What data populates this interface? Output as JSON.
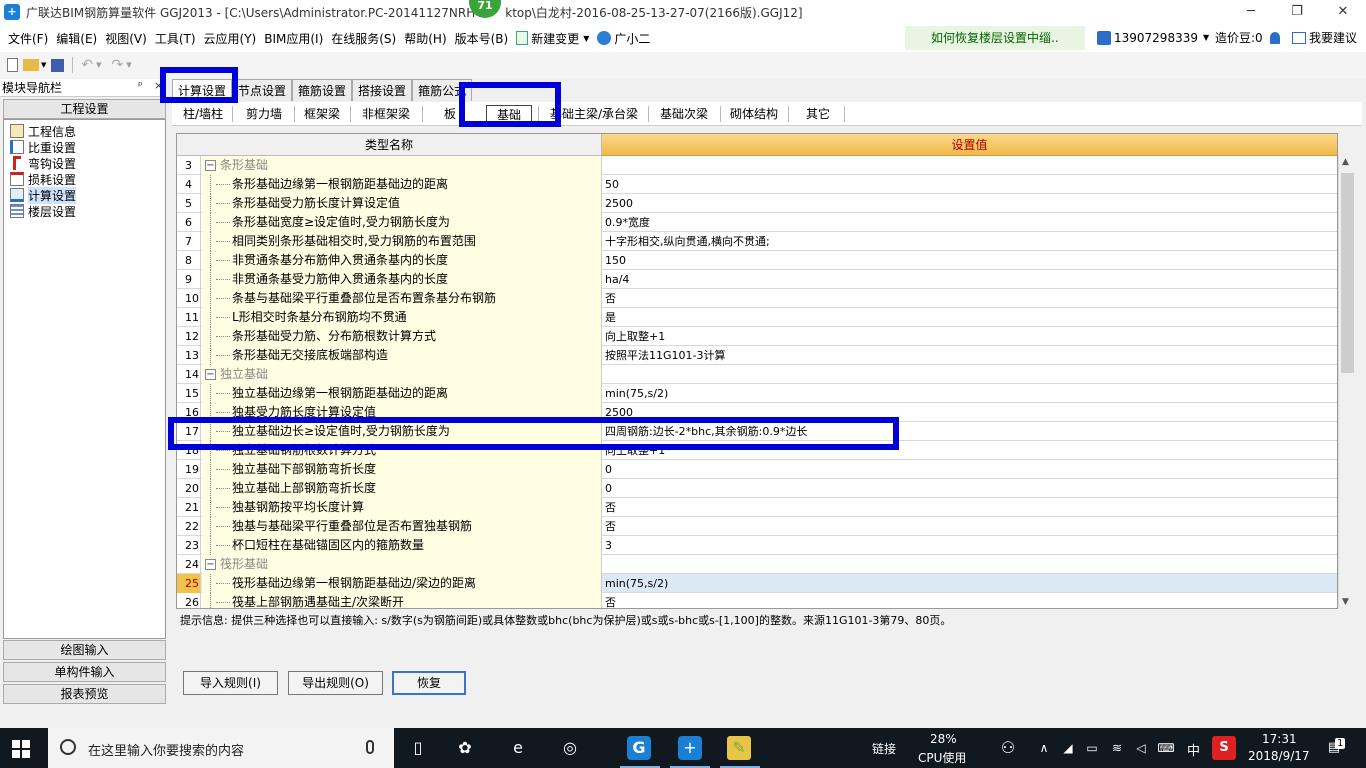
{
  "window": {
    "title": "广联达BIM钢筋算量软件 GGJ2013 - [C:\\Users\\Administrator.PC-20141127NRH",
    "title_tail": "ktop\\白龙村-2016-08-25-13-27-07(2166版).GGJ12]",
    "badge": "71",
    "min_icon": "minimize-icon",
    "restore_icon": "restore-icon",
    "close_icon": "close-icon"
  },
  "menu": {
    "items": [
      "文件(F)",
      "编辑(E)",
      "视图(V)",
      "工具(T)",
      "云应用(Y)",
      "BIM应用(I)",
      "在线服务(S)",
      "帮助(H)",
      "版本号(B)"
    ],
    "new_change": "新建变更",
    "guang_xiao_er": "广小二",
    "hint": "如何恢复楼层设置中缁..",
    "phone": "13907298339",
    "beans": "造价豆:0",
    "suggest": "我要建议"
  },
  "nav": {
    "title": "模块导航栏",
    "pin": "ₚ",
    "close": "×",
    "section": "工程设置",
    "items": [
      {
        "label": "工程信息",
        "icon": "info-icon"
      },
      {
        "label": "比重设置",
        "icon": "weight-icon"
      },
      {
        "label": "弯钩设置",
        "icon": "hook-icon"
      },
      {
        "label": "损耗设置",
        "icon": "loss-icon"
      },
      {
        "label": "计算设置",
        "icon": "calc-icon"
      },
      {
        "label": "楼层设置",
        "icon": "floor-icon"
      }
    ],
    "bottom": [
      "绘图输入",
      "单构件输入",
      "报表预览"
    ]
  },
  "tabs": [
    "计算设置",
    "节点设置",
    "箍筋设置",
    "搭接设置",
    "箍筋公式"
  ],
  "subtabs": [
    "柱/墙柱",
    "剪力墙",
    "框架梁",
    "非框架梁",
    "板",
    "基础",
    "基础主梁/承台梁",
    "基础次梁",
    "砌体结构",
    "其它"
  ],
  "grid": {
    "col_type": "类型名称",
    "col_value": "设置值",
    "rows": [
      {
        "num": "3",
        "name": "条形基础",
        "value": "",
        "group": true
      },
      {
        "num": "4",
        "name": "条形基础边缘第一根钢筋距基础边的距离",
        "value": "50"
      },
      {
        "num": "5",
        "name": "条形基础受力筋长度计算设定值",
        "value": "2500"
      },
      {
        "num": "6",
        "name": "条形基础宽度≥设定值时,受力钢筋长度为",
        "value": "0.9*宽度"
      },
      {
        "num": "7",
        "name": "相同类别条形基础相交时,受力钢筋的布置范围",
        "value": "十字形相交,纵向贯通,横向不贯通;"
      },
      {
        "num": "8",
        "name": "非贯通条基分布筋伸入贯通条基内的长度",
        "value": "150"
      },
      {
        "num": "9",
        "name": "非贯通条基受力筋伸入贯通条基内的长度",
        "value": "ha/4"
      },
      {
        "num": "10",
        "name": "条基与基础梁平行重叠部位是否布置条基分布钢筋",
        "value": "否"
      },
      {
        "num": "11",
        "name": "L形相交时条基分布钢筋均不贯通",
        "value": "是"
      },
      {
        "num": "12",
        "name": "条形基础受力筋、分布筋根数计算方式",
        "value": "向上取整+1"
      },
      {
        "num": "13",
        "name": "条形基础无交接底板端部构造",
        "value": "按照平法11G101-3计算"
      },
      {
        "num": "14",
        "name": "独立基础",
        "value": "",
        "group": true
      },
      {
        "num": "15",
        "name": "独立基础边缘第一根钢筋距基础边的距离",
        "value": "min(75,s/2)"
      },
      {
        "num": "16",
        "name": "独基受力筋长度计算设定值",
        "value": "2500"
      },
      {
        "num": "17",
        "name": "独立基础边长≥设定值时,受力钢筋长度为",
        "value": "四周钢筋:边长-2*bhc,其余钢筋:0.9*边长"
      },
      {
        "num": "18",
        "name": "独立基础钢筋根数计算方式",
        "value": "向上取整+1"
      },
      {
        "num": "19",
        "name": "独立基础下部钢筋弯折长度",
        "value": "0"
      },
      {
        "num": "20",
        "name": "独立基础上部钢筋弯折长度",
        "value": "0"
      },
      {
        "num": "21",
        "name": "独基钢筋按平均长度计算",
        "value": "否"
      },
      {
        "num": "22",
        "name": "独基与基础梁平行重叠部位是否布置独基钢筋",
        "value": "否"
      },
      {
        "num": "23",
        "name": "杯口短柱在基础锚固区内的箍筋数量",
        "value": "3"
      },
      {
        "num": "24",
        "name": "筏形基础",
        "value": "",
        "group": true
      },
      {
        "num": "25",
        "name": "筏形基础边缘第一根钢筋距基础边/梁边的距离",
        "value": "min(75,s/2)",
        "highlight": true
      },
      {
        "num": "26",
        "name": "筏基上部钢筋遇基础主/次梁断开",
        "value": "否"
      }
    ]
  },
  "hint_text": "提示信息: 提供三种选择也可以直接输入: s/数字(s为钢筋间距)或具体整数或bhc(bhc为保护层)或s或s-bhc或s-[1,100]的整数。来源11G101-3第79、80页。",
  "buttons": {
    "import": "导入规则(I)",
    "export": "导出规则(O)",
    "restore": "恢复"
  },
  "taskbar": {
    "search": "在这里输入你要搜索的内容",
    "link": "链接",
    "cpu_pct": "28%",
    "cpu_label": "CPU使用",
    "ime": "中",
    "time": "17:31",
    "date": "2018/9/17",
    "notif": "1"
  }
}
